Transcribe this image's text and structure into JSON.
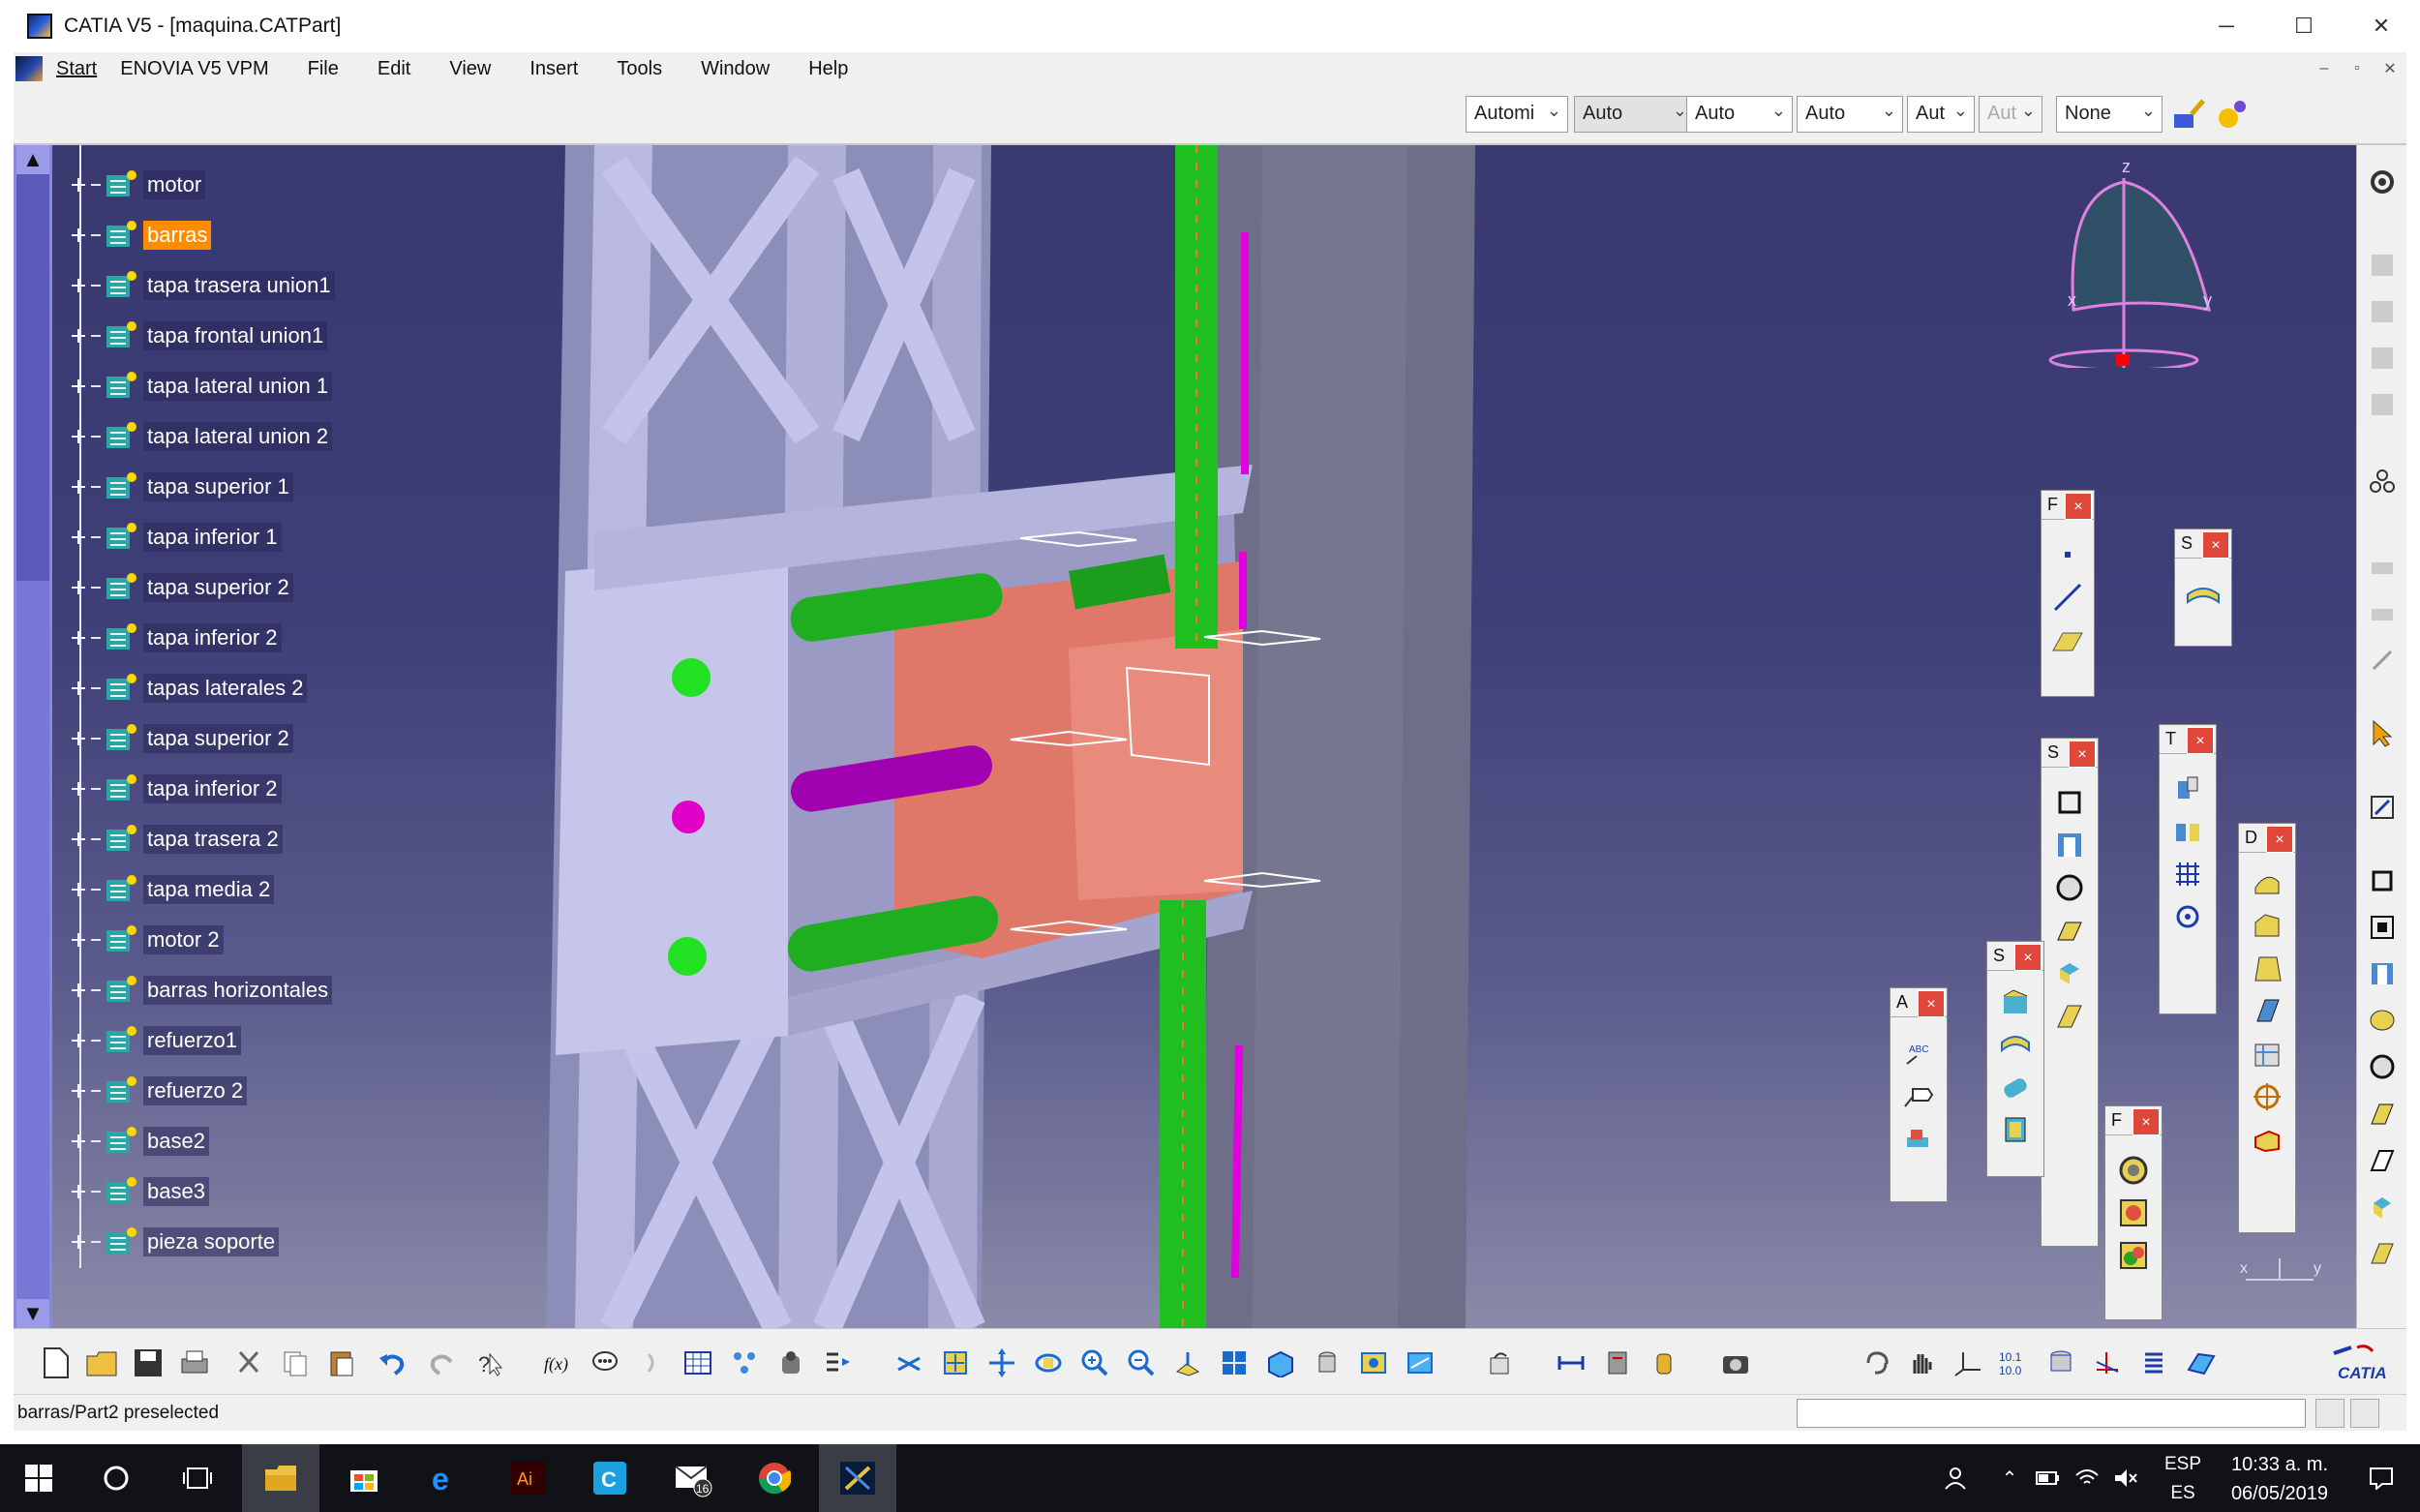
{
  "window": {
    "title": "CATIA V5 - [maquina.CATPart]",
    "minimize": "─",
    "maximize": "☐",
    "close": "✕"
  },
  "menu": {
    "items": [
      "Start",
      "ENOVIA V5 VPM",
      "File",
      "Edit",
      "View",
      "Insert",
      "Tools",
      "Window",
      "Help"
    ],
    "mdi_minimize": "–",
    "mdi_restore": "▫",
    "mdi_close": "✕"
  },
  "graphic_properties": {
    "combos": [
      "Automi",
      "Auto",
      "Auto",
      "Auto",
      "Aut",
      "Aut",
      "None"
    ]
  },
  "tree": {
    "items": [
      {
        "label": "motor",
        "selected": false
      },
      {
        "label": "barras",
        "selected": true
      },
      {
        "label": "tapa trasera union1",
        "selected": false
      },
      {
        "label": "tapa frontal union1",
        "selected": false
      },
      {
        "label": "tapa lateral union 1",
        "selected": false
      },
      {
        "label": "tapa lateral union 2",
        "selected": false
      },
      {
        "label": "tapa superior 1",
        "selected": false
      },
      {
        "label": "tapa inferior 1",
        "selected": false
      },
      {
        "label": "tapa superior 2",
        "selected": false
      },
      {
        "label": "tapa inferior 2",
        "selected": false
      },
      {
        "label": "tapas laterales 2",
        "selected": false
      },
      {
        "label": "tapa superior 2",
        "selected": false
      },
      {
        "label": "tapa inferior 2",
        "selected": false
      },
      {
        "label": "tapa trasera 2",
        "selected": false
      },
      {
        "label": "tapa media 2",
        "selected": false
      },
      {
        "label": "motor 2",
        "selected": false
      },
      {
        "label": "barras horizontales",
        "selected": false
      },
      {
        "label": "refuerzo1",
        "selected": false
      },
      {
        "label": "refuerzo 2",
        "selected": false
      },
      {
        "label": "base2",
        "selected": false
      },
      {
        "label": "base3",
        "selected": false
      },
      {
        "label": "pieza soporte",
        "selected": false
      }
    ]
  },
  "compass": {
    "z": "z",
    "x": "x",
    "y": "y"
  },
  "axis_hint": {
    "x": "x",
    "y": "y"
  },
  "floating_toolbars": {
    "reference": {
      "title": "F",
      "close": "×"
    },
    "surfaces1": {
      "title": "S",
      "close": "×"
    },
    "sketch": {
      "title": "S",
      "close": "×"
    },
    "transform": {
      "title": "T",
      "close": "×"
    },
    "dress": {
      "title": "D",
      "close": "×"
    },
    "surfaces2": {
      "title": "S",
      "close": "×"
    },
    "annotations": {
      "title": "A",
      "close": "×"
    },
    "pattern": {
      "title": "F",
      "close": "×"
    }
  },
  "status": {
    "message": "barras/Part2 preselected"
  },
  "taskbar": {
    "badge_count": "16",
    "lang_top": "ESP",
    "lang_bottom": "ES",
    "time": "10:33 a. m.",
    "date": "06/05/2019"
  },
  "catia_logo": "CATIA",
  "colors": {
    "selection": "#ff8c00",
    "viewport_top": "#393970",
    "frame": "#b8b8e0",
    "green_bar": "#1fbf1f",
    "magenta_bar": "#b000c0",
    "salmon_part": "#e0786a"
  }
}
